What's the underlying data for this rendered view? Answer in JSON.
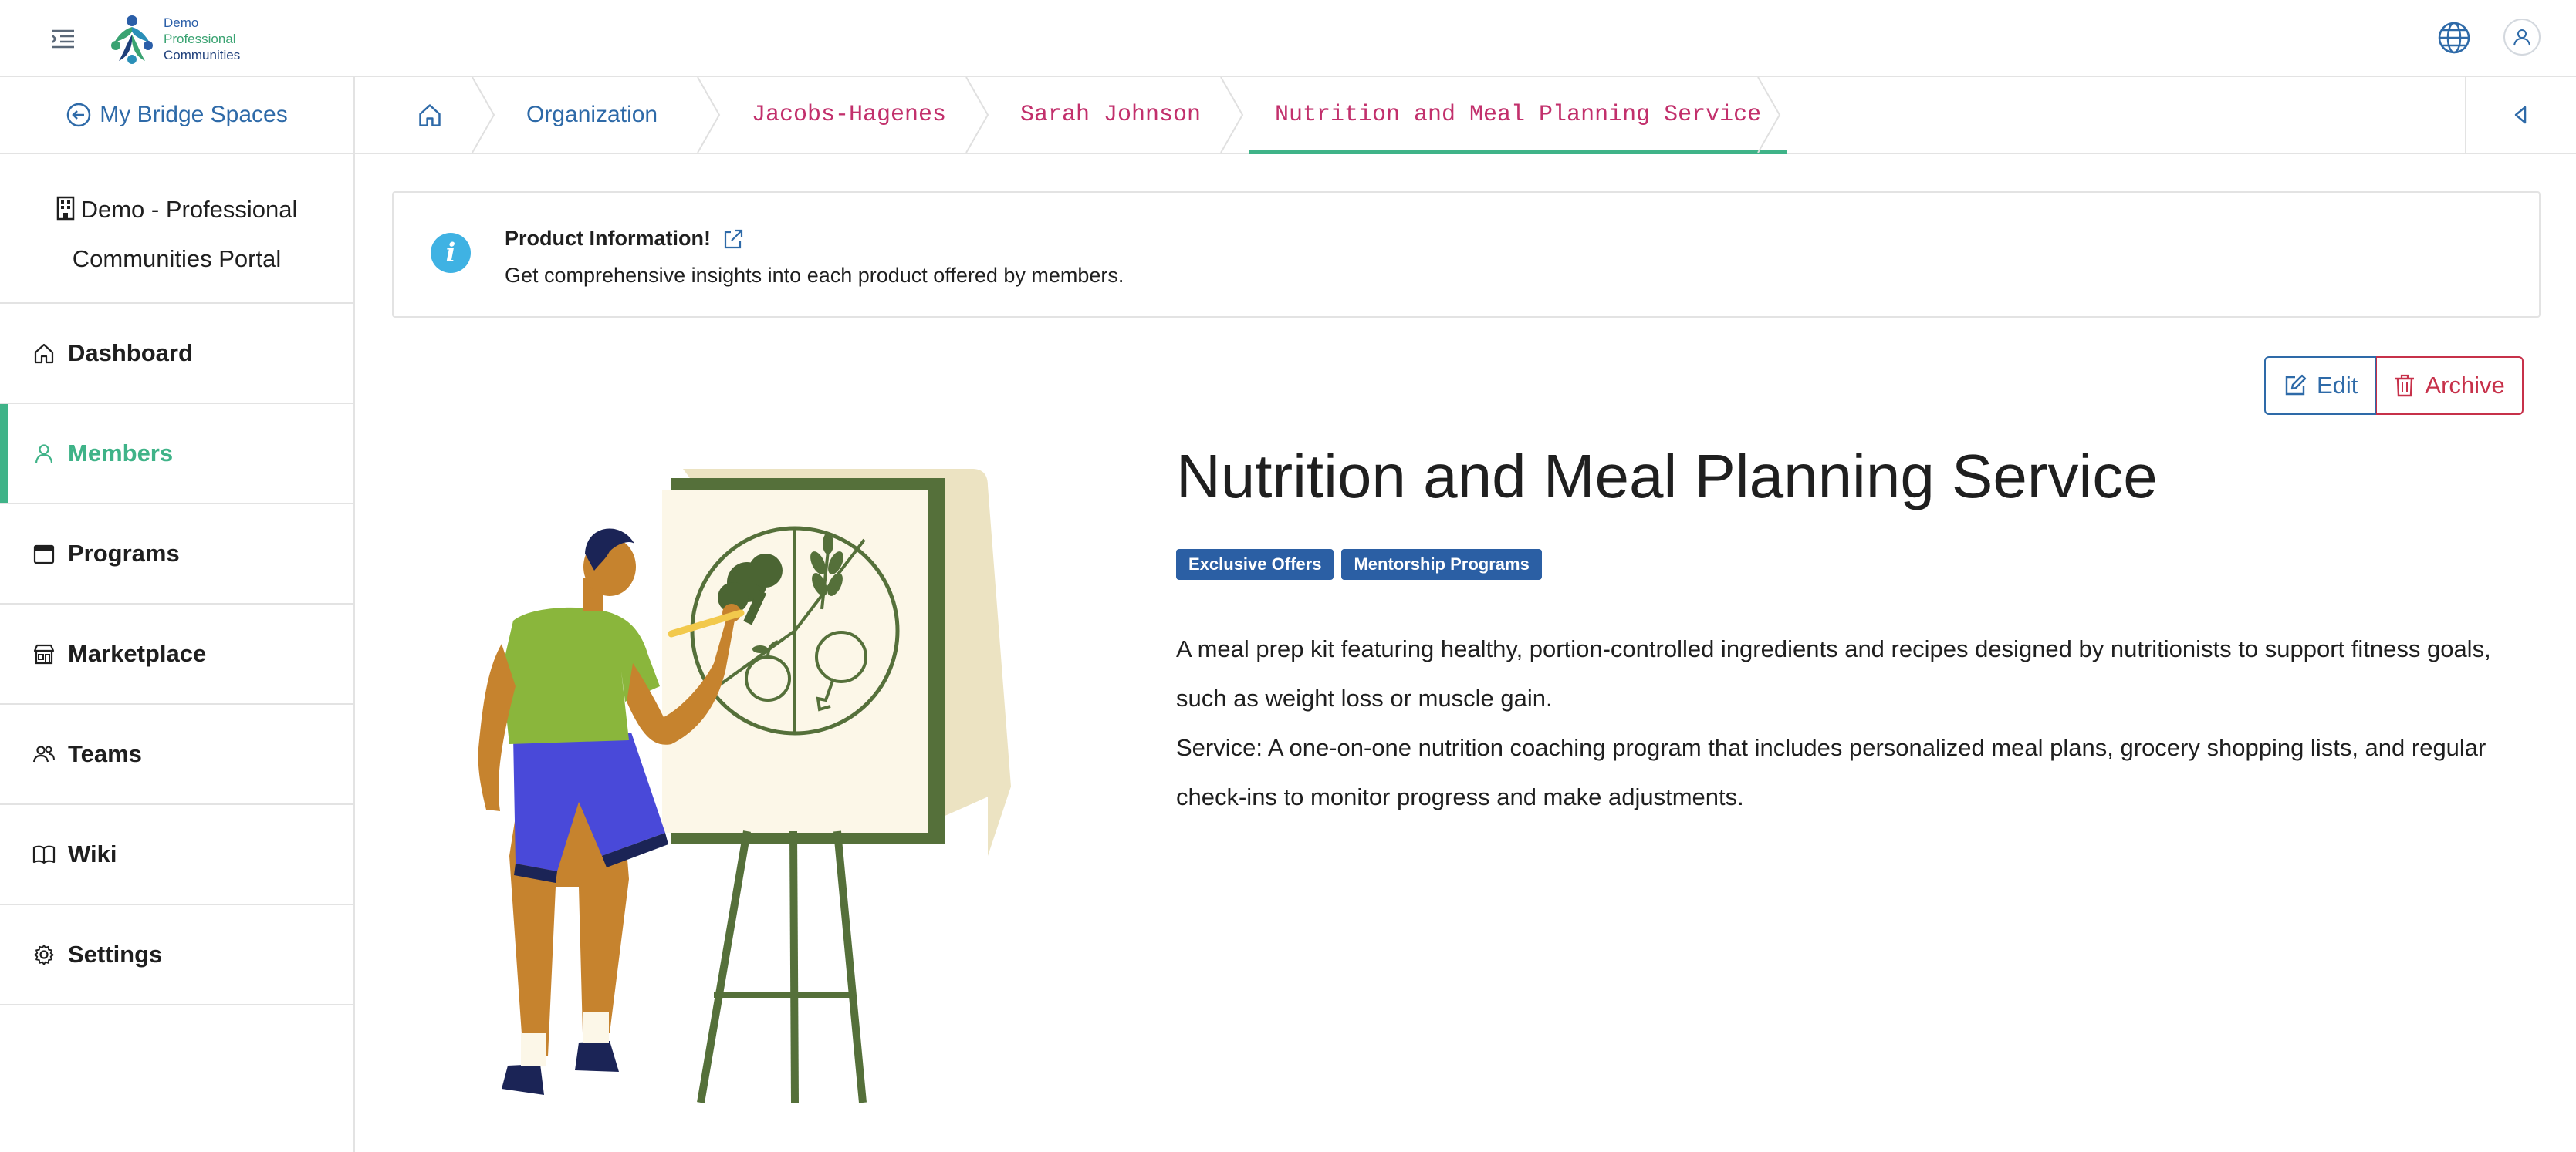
{
  "brand": {
    "logo_lines": [
      "Demo",
      "Professional",
      "Communities"
    ]
  },
  "sidebar": {
    "spaces_link": "My Bridge Spaces",
    "org_name_line1": "Demo - Professional",
    "org_name_line2": "Communities Portal",
    "items": [
      {
        "label": "Dashboard",
        "icon": "home-icon"
      },
      {
        "label": "Members",
        "icon": "user-icon",
        "active": true
      },
      {
        "label": "Programs",
        "icon": "calendar-icon"
      },
      {
        "label": "Marketplace",
        "icon": "store-icon"
      },
      {
        "label": "Teams",
        "icon": "users-icon"
      },
      {
        "label": "Wiki",
        "icon": "book-icon"
      },
      {
        "label": "Settings",
        "icon": "gear-icon"
      }
    ]
  },
  "breadcrumb": {
    "items": [
      "Organization",
      "Jacobs-Hagenes",
      "Sarah Johnson",
      "Nutrition and Meal Planning Service"
    ]
  },
  "info": {
    "title": "Product Information!",
    "text": "Get comprehensive insights into each product offered by members."
  },
  "actions": {
    "edit": "Edit",
    "archive": "Archive"
  },
  "product": {
    "title": "Nutrition and Meal Planning Service",
    "tags": [
      "Exclusive Offers",
      "Mentorship Programs"
    ],
    "description": [
      "A meal prep kit featuring healthy, portion-controlled ingredients and recipes designed by nutritionists to support fitness goals, such as weight loss or muscle gain.",
      "Service: A one-on-one nutrition coaching program that includes personalized meal plans, grocery shopping lists, and regular check-ins to monitor progress and make adjustments."
    ]
  },
  "colors": {
    "accent_green": "#3fb388",
    "link_blue": "#2e6aa8",
    "breadcrumb_pink": "#c2306c",
    "archive_red": "#c7314a",
    "tag_blue": "#2b5fa4",
    "info_blue": "#3fb2e3"
  }
}
